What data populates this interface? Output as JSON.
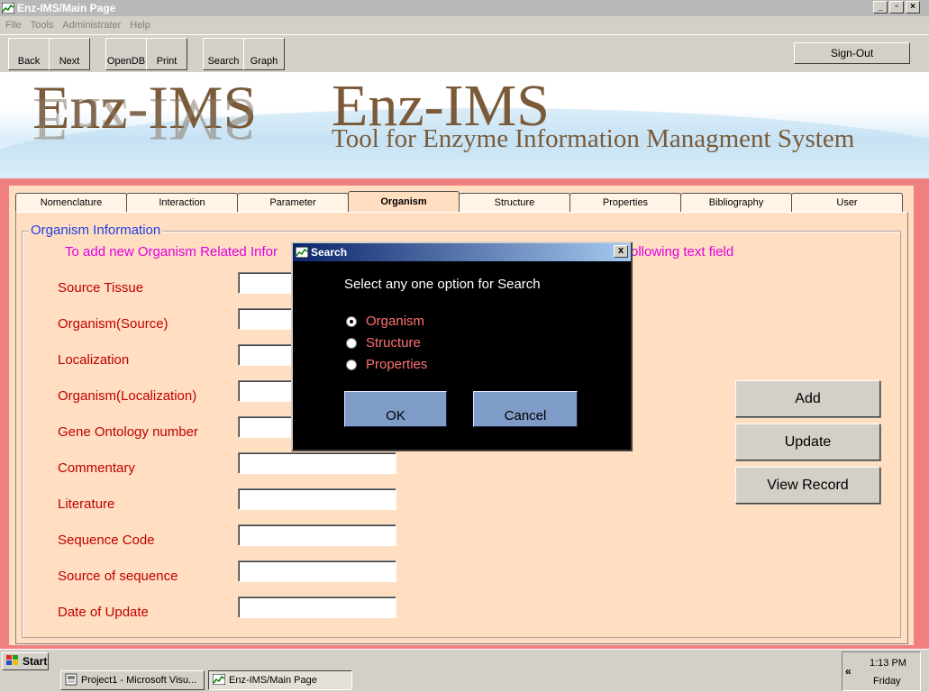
{
  "window": {
    "title": "Enz-IMS/Main Page"
  },
  "menu": [
    "File",
    "Tools",
    "Administrater",
    "Help"
  ],
  "toolbar": {
    "buttons": [
      "Back",
      "Next",
      "OpenDB",
      "Print",
      "Search",
      "Graph"
    ],
    "signout": "Sign-Out"
  },
  "banner": {
    "logo": "Enz-IMS",
    "title": "Enz-IMS",
    "subtitle": "Tool for Enzyme Information Managment System"
  },
  "tabs": [
    "Nomenclature",
    "Interaction",
    "Parameter",
    "Organism",
    "Structure",
    "Properties",
    "Bibliography",
    "User"
  ],
  "active_tab": "Organism",
  "form": {
    "group_title": "Organism Information",
    "info_visible_left": "To add new Organism Related Infor",
    "info_visible_right": "ollowing text field",
    "fields": [
      "Source Tissue",
      "Organism(Source)",
      "Localization",
      "Organism(Localization)",
      "Gene Ontology number",
      "Commentary",
      "Literature",
      "Sequence Code",
      "Source of sequence",
      "Date of Update"
    ],
    "actions": [
      "Add",
      "Update",
      "View Record"
    ]
  },
  "dialog": {
    "title": "Search",
    "close": "x",
    "prompt": "Select any one option for Search",
    "options": [
      "Organism",
      "Structure",
      "Properties"
    ],
    "selected": "Organism",
    "ok": "OK",
    "cancel": "Cancel"
  },
  "taskbar": {
    "start": "Start",
    "tasks": [
      "Project1 - Microsoft Visu...",
      "Enz-IMS/Main Page"
    ],
    "time": "1:13 PM",
    "day": "Friday",
    "chevron": "«"
  },
  "colors": {
    "label_red": "#c00000",
    "info_magenta": "#e000e0",
    "group_blue": "#2040e0",
    "panel_peach": "#ffdec2",
    "frame_salmon": "#f08080",
    "banner_brown": "#7a5a38"
  }
}
